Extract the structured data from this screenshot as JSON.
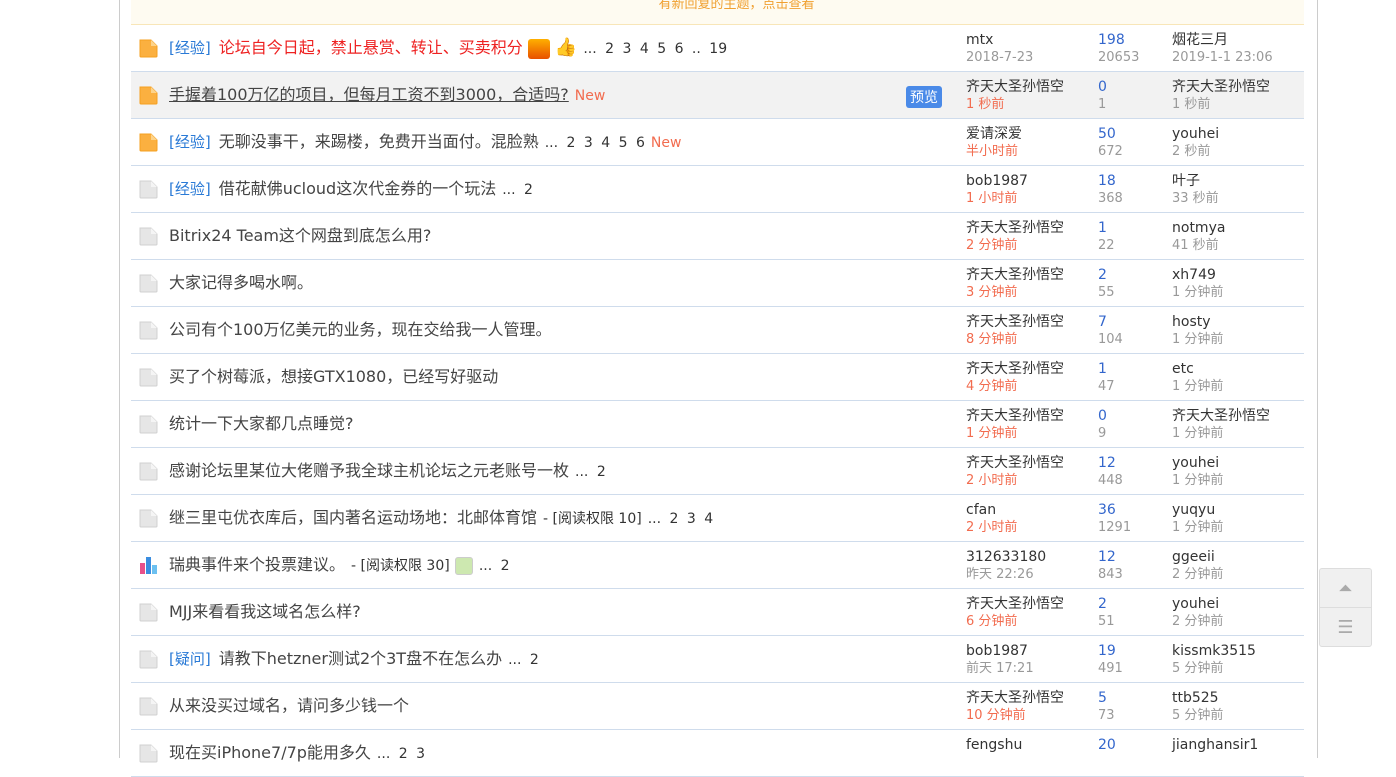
{
  "notice": "有新回复的主题，点击查看",
  "preview_label": "预览",
  "threads": [
    {
      "icon": "folder-hot",
      "tag": "[经验]",
      "title": "论坛自今日起，禁止悬赏、转让、买卖积分",
      "style": "red",
      "badges": [
        "hot",
        "thumb"
      ],
      "pages": "... 2 3 4 5 6 .. 19",
      "author": "mtx",
      "author_time": "2018-7-23",
      "author_time_red": false,
      "replies": "198",
      "views": "20653",
      "last_user": "烟花三月",
      "last_time": "2019-1-1 23:06"
    },
    {
      "icon": "folder-hot",
      "title": "手握着100万亿的项目，但每月工资不到3000，合适吗?",
      "style": "ul",
      "new": "New",
      "highlight": true,
      "preview": true,
      "author": "齐天大圣孙悟空",
      "author_time": "1 秒前",
      "author_time_red": true,
      "replies": "0",
      "views": "1",
      "last_user": "齐天大圣孙悟空",
      "last_time": "1 秒前"
    },
    {
      "icon": "folder-hot",
      "tag": "[经验]",
      "title": "无聊没事干，来踢楼，免费开当面付。混脸熟",
      "pages": "... 2 3 4 5 6",
      "new": "New",
      "author": "爱请深爱",
      "author_time": "半小时前",
      "author_time_red": true,
      "replies": "50",
      "views": "672",
      "last_user": "youhei",
      "last_time": "2 秒前"
    },
    {
      "icon": "folder",
      "tag": "[经验]",
      "title": "借花献佛ucloud这次代金券的一个玩法",
      "pages": "... 2",
      "author": "bob1987",
      "author_time": "1 小时前",
      "author_time_red": true,
      "replies": "18",
      "views": "368",
      "last_user": "叶子",
      "last_time": "33 秒前"
    },
    {
      "icon": "folder",
      "title": "Bitrix24 Team这个网盘到底怎么用?",
      "author": "齐天大圣孙悟空",
      "author_time": "2 分钟前",
      "author_time_red": true,
      "replies": "1",
      "views": "22",
      "last_user": "notmya",
      "last_time": "41 秒前"
    },
    {
      "icon": "folder",
      "title": "大家记得多喝水啊。",
      "author": "齐天大圣孙悟空",
      "author_time": "3 分钟前",
      "author_time_red": true,
      "replies": "2",
      "views": "55",
      "last_user": "xh749",
      "last_time": "1 分钟前"
    },
    {
      "icon": "folder",
      "title": "公司有个100万亿美元的业务，现在交给我一人管理。",
      "author": "齐天大圣孙悟空",
      "author_time": "8 分钟前",
      "author_time_red": true,
      "replies": "7",
      "views": "104",
      "last_user": "hosty",
      "last_time": "1 分钟前"
    },
    {
      "icon": "folder",
      "title": "买了个树莓派，想接GTX1080，已经写好驱动",
      "author": "齐天大圣孙悟空",
      "author_time": "4 分钟前",
      "author_time_red": true,
      "replies": "1",
      "views": "47",
      "last_user": "etc",
      "last_time": "1 分钟前"
    },
    {
      "icon": "folder",
      "title": "统计一下大家都几点睡觉?",
      "author": "齐天大圣孙悟空",
      "author_time": "1 分钟前",
      "author_time_red": true,
      "replies": "0",
      "views": "9",
      "last_user": "齐天大圣孙悟空",
      "last_time": "1 分钟前"
    },
    {
      "icon": "folder",
      "title": "感谢论坛里某位大佬赠予我全球主机论坛之元老账号一枚",
      "pages": "... 2",
      "author": "齐天大圣孙悟空",
      "author_time": "2 小时前",
      "author_time_red": true,
      "replies": "12",
      "views": "448",
      "last_user": "youhei",
      "last_time": "1 分钟前"
    },
    {
      "icon": "folder",
      "title": "继三里屯优衣库后，国内著名运动场地：北邮体育馆",
      "perm": "- [阅读权限 10]",
      "pages": "... 2 3 4",
      "author": "cfan",
      "author_time": "2 小时前",
      "author_time_red": true,
      "replies": "36",
      "views": "1291",
      "last_user": "yuqyu",
      "last_time": "1 分钟前"
    },
    {
      "icon": "poll",
      "title": "瑞典事件来个投票建议。",
      "perm": "- [阅读权限 30]",
      "badges": [
        "image"
      ],
      "pages": "... 2",
      "author": "312633180",
      "author_time": "昨天 22:26",
      "author_time_red": false,
      "replies": "12",
      "views": "843",
      "last_user": "ggeeii",
      "last_time": "2 分钟前"
    },
    {
      "icon": "folder",
      "title": "MJJ来看看我这域名怎么样?",
      "author": "齐天大圣孙悟空",
      "author_time": "6 分钟前",
      "author_time_red": true,
      "replies": "2",
      "views": "51",
      "last_user": "youhei",
      "last_time": "2 分钟前"
    },
    {
      "icon": "folder",
      "tag": "[疑问]",
      "title": "请教下hetzner测试2个3T盘不在怎么办",
      "pages": "... 2",
      "author": "bob1987",
      "author_time": "前天 17:21",
      "author_time_red": false,
      "replies": "19",
      "views": "491",
      "last_user": "kissmk3515",
      "last_time": "5 分钟前"
    },
    {
      "icon": "folder",
      "title": "从来没买过域名，请问多少钱一个",
      "author": "齐天大圣孙悟空",
      "author_time": "10 分钟前",
      "author_time_red": true,
      "replies": "5",
      "views": "73",
      "last_user": "ttb525",
      "last_time": "5 分钟前"
    },
    {
      "icon": "folder",
      "title": "现在买iPhone7/7p能用多久",
      "pages": "... 2 3",
      "author": "fengshu",
      "author_time": "",
      "author_time_red": false,
      "replies": "20",
      "views": "",
      "last_user": "jianghansir1",
      "last_time": ""
    }
  ]
}
